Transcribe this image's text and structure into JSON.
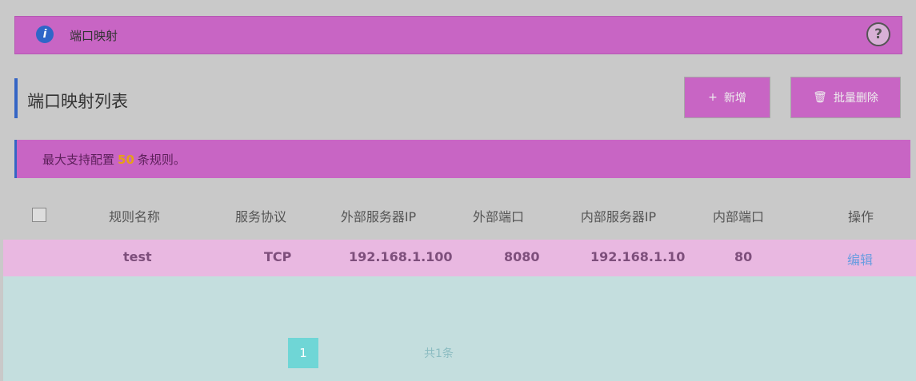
{
  "header": {
    "title": "端口映射",
    "info_icon": "info-icon",
    "help_icon": "help-icon",
    "help_symbol": "?"
  },
  "section": {
    "title": "端口映射列表",
    "buttons": [
      {
        "label": "新增",
        "icon": "plus-icon"
      },
      {
        "label": "批量删除",
        "icon": "trash-icon"
      }
    ]
  },
  "notice": {
    "prefix": "最大支持配置",
    "count": "50",
    "suffix": "条规则。"
  },
  "table": {
    "headers": [
      "规则名称",
      "服务协议",
      "外部服务器IP",
      "外部端口",
      "内部服务器IP",
      "内部端口",
      "操作"
    ],
    "row": {
      "name": "test",
      "protocol": "TCP",
      "ext_ip": "192.168.1.100",
      "ext_port": "8080",
      "int_ip": "192.168.1.10",
      "int_port": "80",
      "action": "编辑"
    }
  },
  "pagination": {
    "current": "1",
    "total_text": "共1条"
  },
  "colors": {
    "accent": "#3565c5",
    "bar": "#c865c4",
    "highlight": "#e6a019"
  }
}
